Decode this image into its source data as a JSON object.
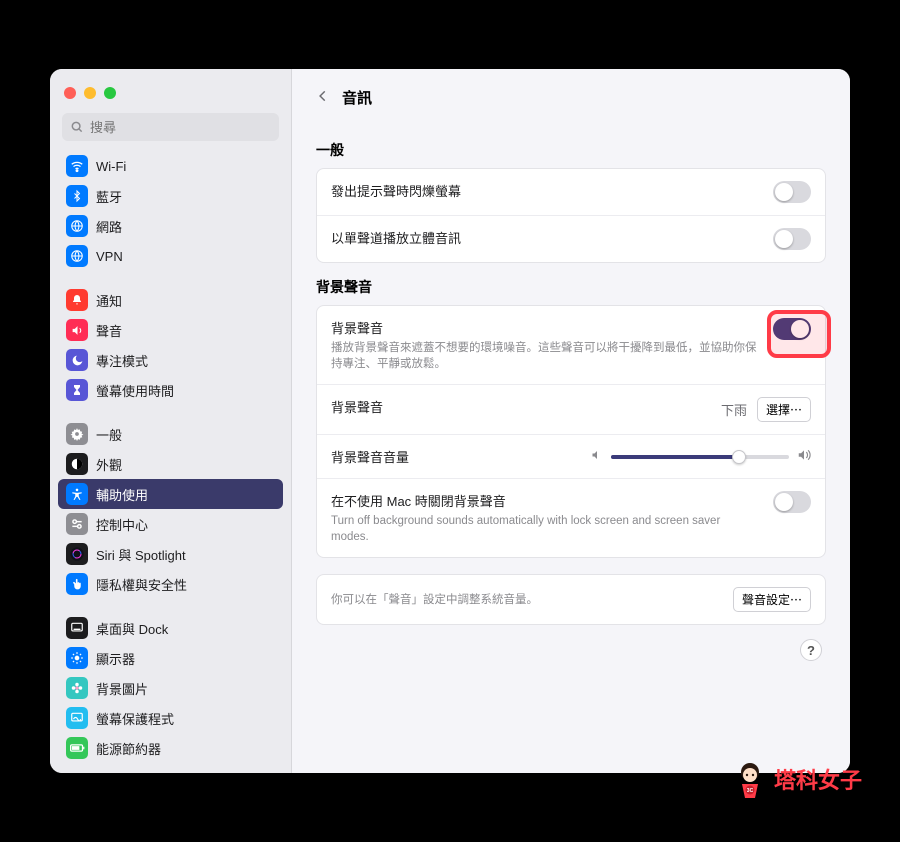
{
  "search": {
    "placeholder": "搜尋"
  },
  "sidebar": {
    "group1": [
      {
        "label": "Wi-Fi",
        "icon": "wifi",
        "bg": "#007aff"
      },
      {
        "label": "藍牙",
        "icon": "bluetooth",
        "bg": "#007aff"
      },
      {
        "label": "網路",
        "icon": "globe",
        "bg": "#007aff"
      },
      {
        "label": "VPN",
        "icon": "globe",
        "bg": "#007aff"
      }
    ],
    "group2": [
      {
        "label": "通知",
        "icon": "bell",
        "bg": "#ff3b30"
      },
      {
        "label": "聲音",
        "icon": "speaker",
        "bg": "#ff2d55"
      },
      {
        "label": "專注模式",
        "icon": "moon",
        "bg": "#5856d6"
      },
      {
        "label": "螢幕使用時間",
        "icon": "hourglass",
        "bg": "#5856d6"
      }
    ],
    "group3": [
      {
        "label": "一般",
        "icon": "gear",
        "bg": "#8e8e93"
      },
      {
        "label": "外觀",
        "icon": "contrast",
        "bg": "#1c1c1e"
      },
      {
        "label": "輔助使用",
        "icon": "accessibility",
        "bg": "#007aff",
        "selected": true
      },
      {
        "label": "控制中心",
        "icon": "switches",
        "bg": "#8e8e93"
      },
      {
        "label": "Siri 與 Spotlight",
        "icon": "siri",
        "bg": "#1c1c1e"
      },
      {
        "label": "隱私權與安全性",
        "icon": "hand",
        "bg": "#007aff"
      }
    ],
    "group4": [
      {
        "label": "桌面與 Dock",
        "icon": "dock",
        "bg": "#1c1c1e"
      },
      {
        "label": "顯示器",
        "icon": "sun",
        "bg": "#007aff"
      },
      {
        "label": "背景圖片",
        "icon": "flower",
        "bg": "#34c7c0"
      },
      {
        "label": "螢幕保護程式",
        "icon": "screensaver",
        "bg": "#22bdf0"
      },
      {
        "label": "能源節約器",
        "icon": "battery",
        "bg": "#34c759"
      }
    ]
  },
  "header": {
    "title": "音訊"
  },
  "sections": {
    "general_title": "一般",
    "flash": {
      "label": "發出提示聲時閃爍螢幕",
      "on": false
    },
    "mono": {
      "label": "以單聲道播放立體音訊",
      "on": false
    },
    "bg_title": "背景聲音",
    "bg_main": {
      "label": "背景聲音",
      "sub": "播放背景聲音來遮蓋不想要的環境噪音。這些聲音可以將干擾降到最低，並協助你保持專注、平靜或放鬆。",
      "on": true
    },
    "bg_select": {
      "label": "背景聲音",
      "value": "下雨",
      "button": "選擇⋯"
    },
    "bg_volume": {
      "label": "背景聲音音量",
      "value": 0.72
    },
    "bg_lock": {
      "label": "在不使用 Mac 時關閉背景聲音",
      "sub": "Turn off background sounds automatically with lock screen and screen saver modes.",
      "on": false
    },
    "footer_hint": "你可以在「聲音」設定中調整系統音量。",
    "footer_btn": "聲音設定⋯"
  },
  "watermark": "塔科女子"
}
